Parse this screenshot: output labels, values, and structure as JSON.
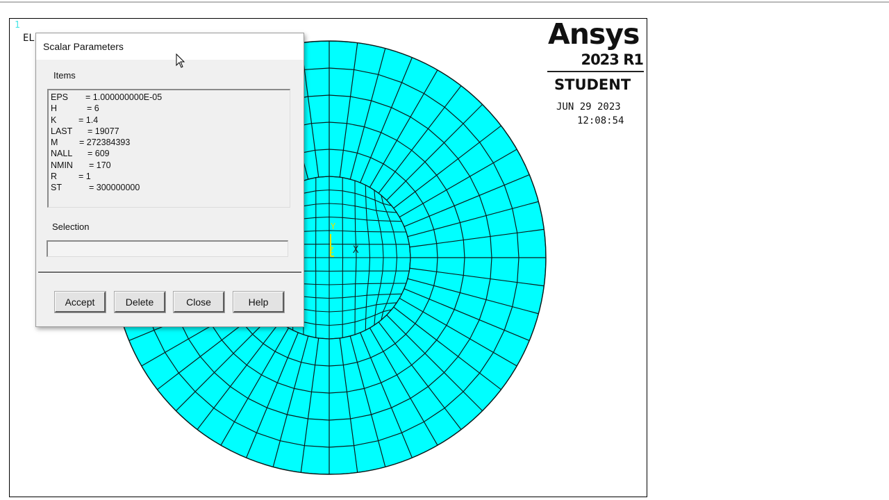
{
  "graphics": {
    "window_number": "1",
    "plot_label": "EL",
    "logo": {
      "word": "Ansys",
      "version": "2023 R1",
      "edition": "STUDENT"
    },
    "date": "JUN 29 2023",
    "time": "12:08:54",
    "triad": {
      "y": "Y",
      "z": "Z",
      "x": "X"
    },
    "colors": {
      "mesh_fill": "#00ffff",
      "mesh_line": "#0b1b1b",
      "triad": "#e5e500"
    }
  },
  "dialog": {
    "title": "Scalar Parameters",
    "items_label": "Items",
    "items": [
      {
        "name": "EPS",
        "value": "= 1.000000000E-05"
      },
      {
        "name": "H",
        "value": "= 6"
      },
      {
        "name": "K",
        "value": "= 1.4"
      },
      {
        "name": "LAST",
        "value": "= 19077"
      },
      {
        "name": "M",
        "value": "= 272384393"
      },
      {
        "name": "NALL",
        "value": "= 609"
      },
      {
        "name": "NMIN",
        "value": "= 170"
      },
      {
        "name": "R",
        "value": "= 1"
      },
      {
        "name": "ST",
        "value": "= 300000000"
      }
    ],
    "selection_label": "Selection",
    "selection_value": "",
    "buttons": {
      "accept": "Accept",
      "delete": "Delete",
      "close": "Close",
      "help": "Help"
    }
  }
}
